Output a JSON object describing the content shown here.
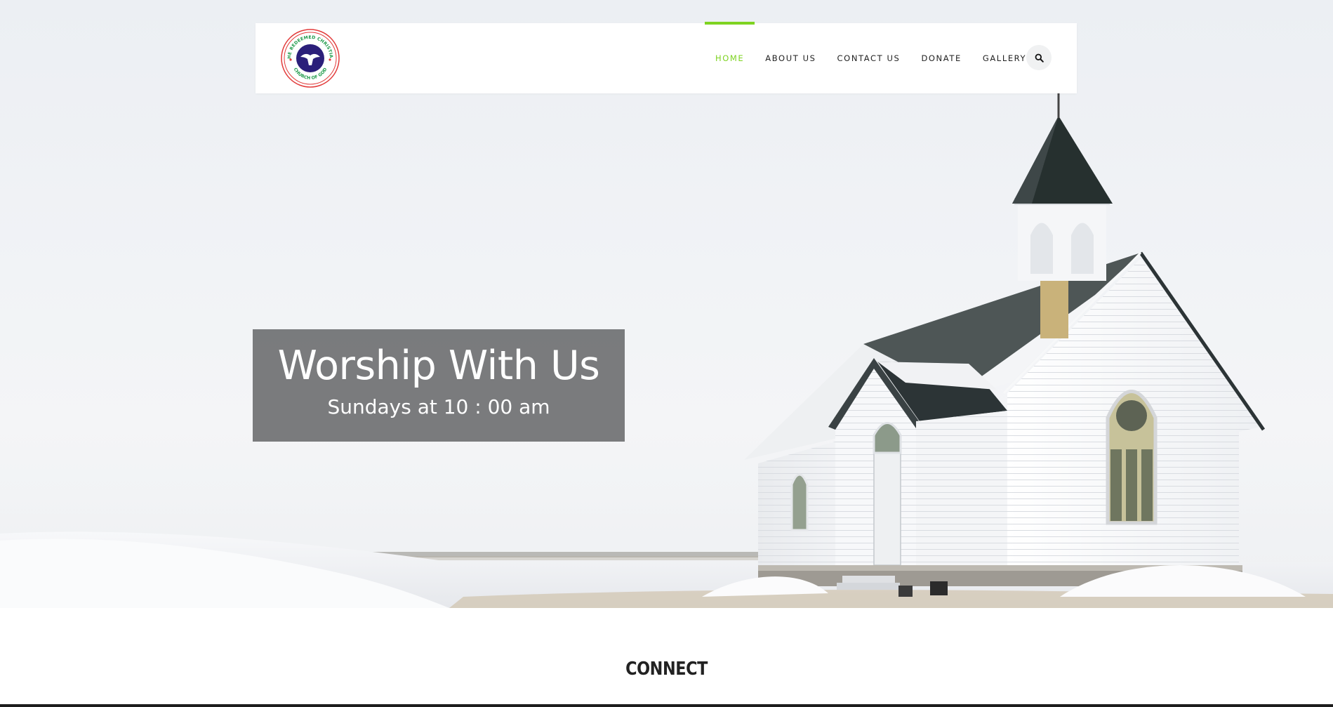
{
  "header": {
    "logo_text_top": "THE REDEEMED CHRISTIAN",
    "logo_text_bottom": "CHURCH OF GOD",
    "nav": [
      {
        "label": "HOME",
        "active": true
      },
      {
        "label": "ABOUT US",
        "active": false
      },
      {
        "label": "CONTACT US",
        "active": false
      },
      {
        "label": "DONATE",
        "active": false
      },
      {
        "label": "GALLERY",
        "active": false
      }
    ],
    "search_icon": "search-icon"
  },
  "hero": {
    "title": "Worship With Us",
    "subtitle": "Sundays at 10 : 00 am"
  },
  "section": {
    "title": "CONNECT"
  },
  "colors": {
    "accent": "#7ed321",
    "caption_bg": "#707173",
    "text_dark": "#222222"
  }
}
